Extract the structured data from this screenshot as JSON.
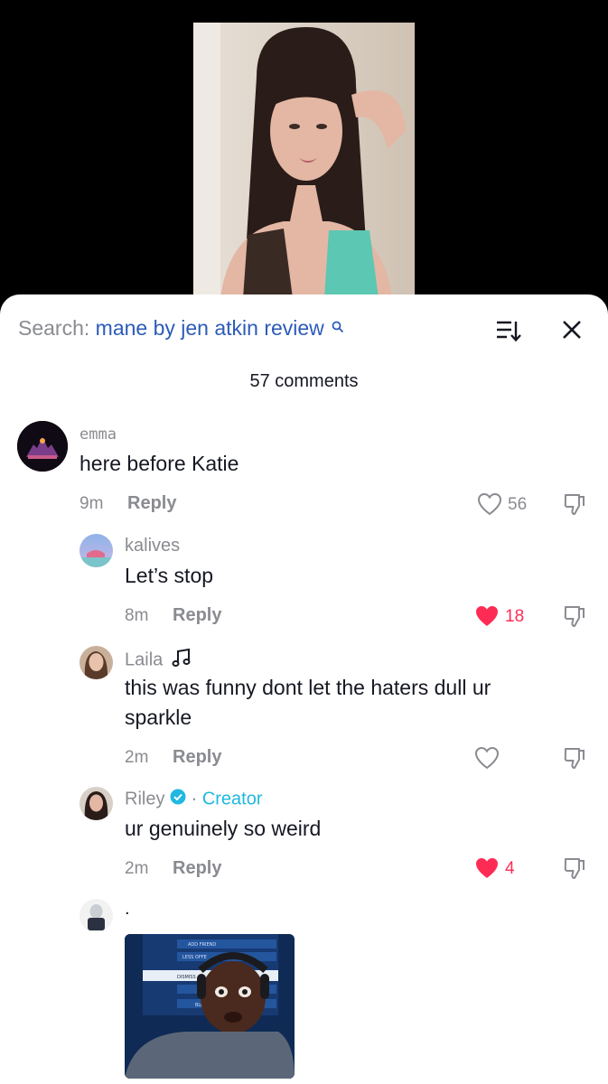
{
  "search": {
    "prefix": "Search:",
    "query": "mane by jen atkin review"
  },
  "comments_count": "57 comments",
  "comments": [
    {
      "user": "emma",
      "text": "here before Katie",
      "time": "9m",
      "reply": "Reply",
      "likes": "56",
      "liked": false
    },
    {
      "user": "kalives",
      "text": "Let’s stop",
      "time": "8m",
      "reply": "Reply",
      "likes": "18",
      "liked": true
    },
    {
      "user": "Laila",
      "text": "this was funny dont let the haters dull ur sparkle",
      "time": "2m",
      "reply": "Reply",
      "likes": "",
      "liked": false,
      "has_music_icon": true
    },
    {
      "user": "Riley",
      "creator_label": "Creator",
      "separator": "·",
      "verified": true,
      "text": "ur genuinely so weird",
      "time": "2m",
      "reply": "Reply",
      "likes": "4",
      "liked": true
    },
    {
      "user": ".",
      "text": "",
      "has_gif": true
    }
  ],
  "gif_text": {
    "line1": "ADD FRIEND",
    "line2": "LESS OFFE",
    "line3": "DISMISS",
    "line4": "BLO"
  },
  "colors": {
    "accent_red": "#fe2c55",
    "link_blue": "#2c5bb8",
    "creator_cyan": "#20b8e0",
    "muted_gray": "#8a8b91"
  }
}
